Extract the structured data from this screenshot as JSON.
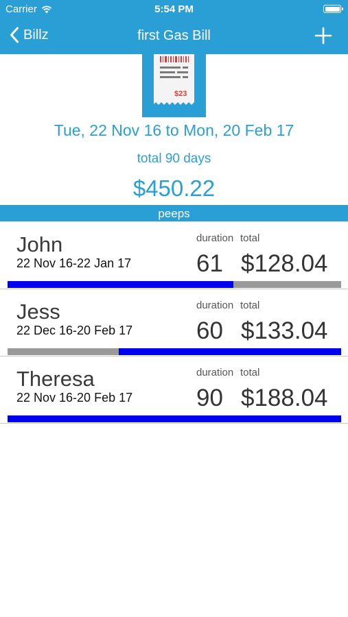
{
  "status_bar": {
    "carrier": "Carrier",
    "time": "5:54 PM"
  },
  "nav": {
    "back_label": "Billz",
    "title": "first Gas Bill"
  },
  "bill": {
    "receipt_amount": "$23",
    "date_range": "Tue, 22 Nov 16 to Mon, 20 Feb 17",
    "total_days": "total 90 days",
    "amount": "$450.22"
  },
  "section_label": "peeps",
  "people": [
    {
      "name": "John",
      "range": "22 Nov 16-22 Jan 17",
      "duration_header": "duration",
      "total_header": "total",
      "duration": "61",
      "total": "$128.04",
      "bar_start": 0.0,
      "bar_end": 0.677
    },
    {
      "name": "Jess",
      "range": "22 Dec 16-20 Feb 17",
      "duration_header": "duration",
      "total_header": "total",
      "duration": "60",
      "total": "$133.04",
      "bar_start": 0.333,
      "bar_end": 1.0
    },
    {
      "name": "Theresa",
      "range": "22 Nov 16-20 Feb 17",
      "duration_header": "duration",
      "total_header": "total",
      "duration": "90",
      "total": "$188.04",
      "bar_start": 0.0,
      "bar_end": 1.0
    }
  ],
  "colors": {
    "accent": "#2a9fd6",
    "bar_fill": "#0000f0",
    "bar_track": "#9a9a9a"
  }
}
